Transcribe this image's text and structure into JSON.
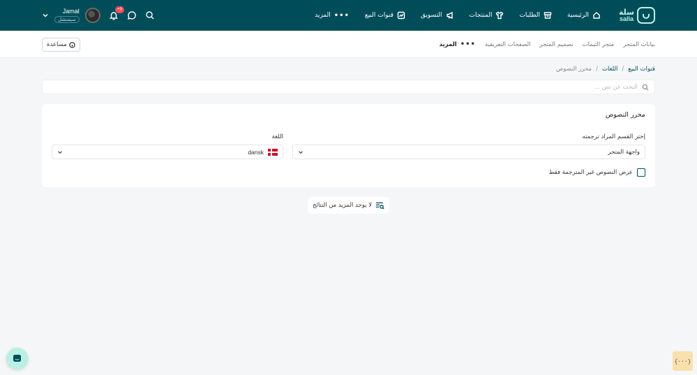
{
  "brand": {
    "ar": "سلة",
    "en": "salla"
  },
  "nav": {
    "home": "الرئيسية",
    "orders": "الطلبات",
    "products": "المنتجات",
    "marketing": "التسويق",
    "sales_channels": "قنوات البيع",
    "more": "المزيد"
  },
  "user": {
    "name": "Jamal",
    "role": "سيسشل",
    "notifications": "+9"
  },
  "subnav": {
    "store_data": "بيانات المتجر",
    "themes_store": "متجر الثيمات",
    "store_design": "تصميم المتجر",
    "landing_pages": "الصفحات التعريفية",
    "more": "المزيد"
  },
  "help_label": "مساعدة",
  "breadcrumb": {
    "sales_channels": "قنوات البيع",
    "languages": "اللغات",
    "current": "محرر النصوص"
  },
  "search": {
    "placeholder": "البحث عن نص ..."
  },
  "card": {
    "title": "محرر النصوص",
    "section_label": "إختر القسم المراد ترجمته",
    "section_value": "واجهة المتجر",
    "language_label": "اللغة",
    "language_value": "dansk",
    "checkbox_label": "عرض النصوص غير المترجمة فقط"
  },
  "no_more_results": "لا يوجد المزيد من النتائج",
  "dev_button": "{···}",
  "colors": {
    "primary": "#004d5a",
    "accent": "#baf0e3",
    "badge": "#f04a5b"
  }
}
